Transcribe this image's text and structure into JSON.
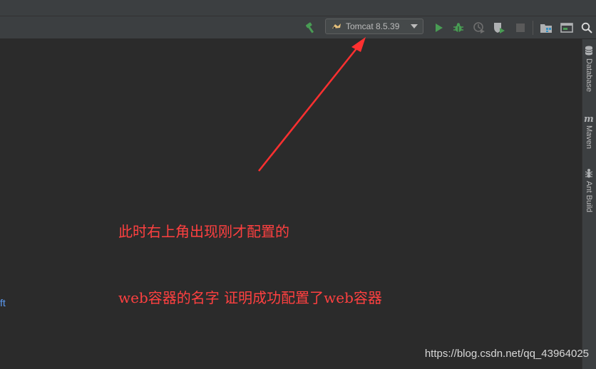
{
  "toolbar": {
    "run_config": {
      "label": "Tomcat 8.5.39"
    },
    "icons": [
      "build-hammer-icon",
      "tomcat-icon",
      "run-icon",
      "debug-icon",
      "coverage-icon",
      "profile-icon",
      "stop-icon",
      "project-structure-icon",
      "terminal-icon",
      "search-icon"
    ]
  },
  "right_strip": {
    "tabs": [
      {
        "label": "Database",
        "icon": "database-icon"
      },
      {
        "label": "Maven",
        "icon": "maven-icon"
      },
      {
        "label": "Ant Build",
        "icon": "ant-icon"
      }
    ]
  },
  "editor": {
    "code_fragment": "ft"
  },
  "annotation": {
    "line1": "此时右上角出现刚才配置的",
    "line2": "web容器的名字 证明成功配置了web容器",
    "color": "#ff4040"
  },
  "watermark": "https://blog.csdn.net/qq_43964025"
}
